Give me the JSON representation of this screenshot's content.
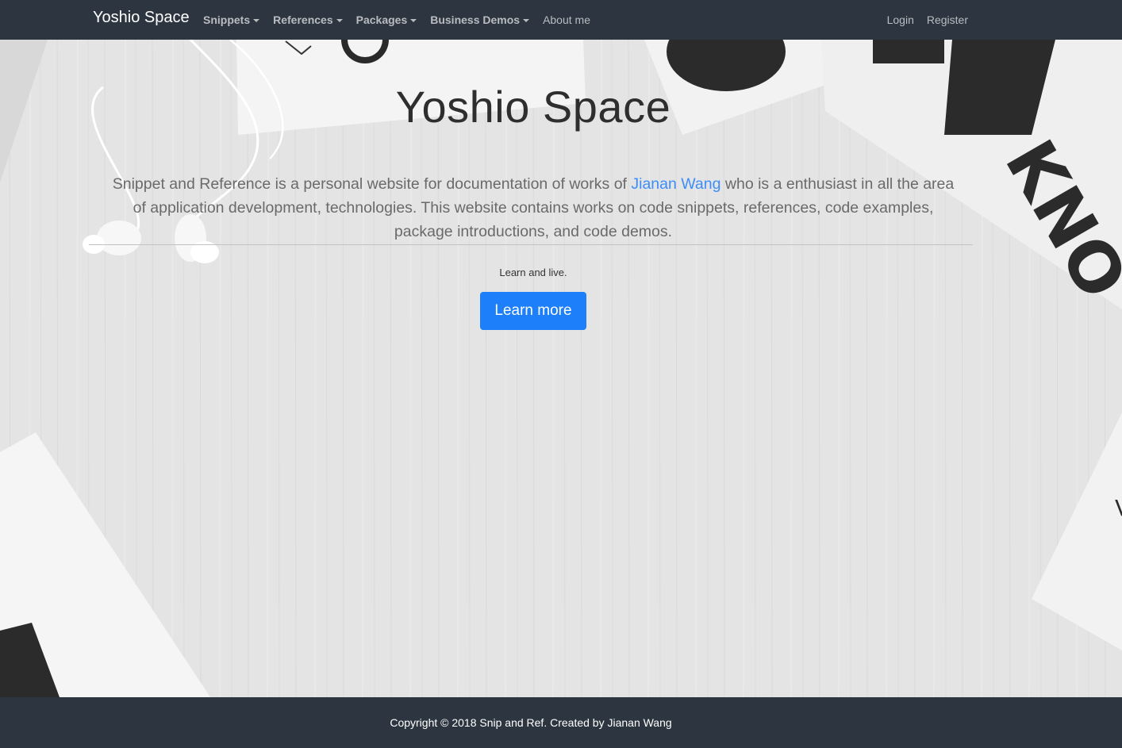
{
  "navbar": {
    "brand": "Yoshio Space",
    "left_items": [
      {
        "label": "Snippets",
        "dropdown": true
      },
      {
        "label": "References",
        "dropdown": true
      },
      {
        "label": "Packages",
        "dropdown": true
      },
      {
        "label": "Business Demos",
        "dropdown": true
      },
      {
        "label": "About me",
        "dropdown": false
      }
    ],
    "right_items": [
      {
        "label": "Login"
      },
      {
        "label": "Register"
      }
    ]
  },
  "hero": {
    "title": "Yoshio Space",
    "lead_before_link": "Snippet and Reference is a personal website for documentation of works of ",
    "lead_link": "Jianan Wang",
    "lead_after_link": " who is a enthusiast in all the area of application development, technologies. This website contains works on code snippets, references, code examples, package introductions, and code demos.",
    "tagline": "Learn and live.",
    "button_label": "Learn more",
    "background_text": "KNO"
  },
  "footer": {
    "text": "Copyright © 2018 Snip and Ref. Created by Jianan Wang"
  },
  "colors": {
    "navbar_bg": "#2d3640",
    "footer_bg": "#2d3640",
    "link": "#3c8dfa",
    "button": "#1e7ffb"
  }
}
